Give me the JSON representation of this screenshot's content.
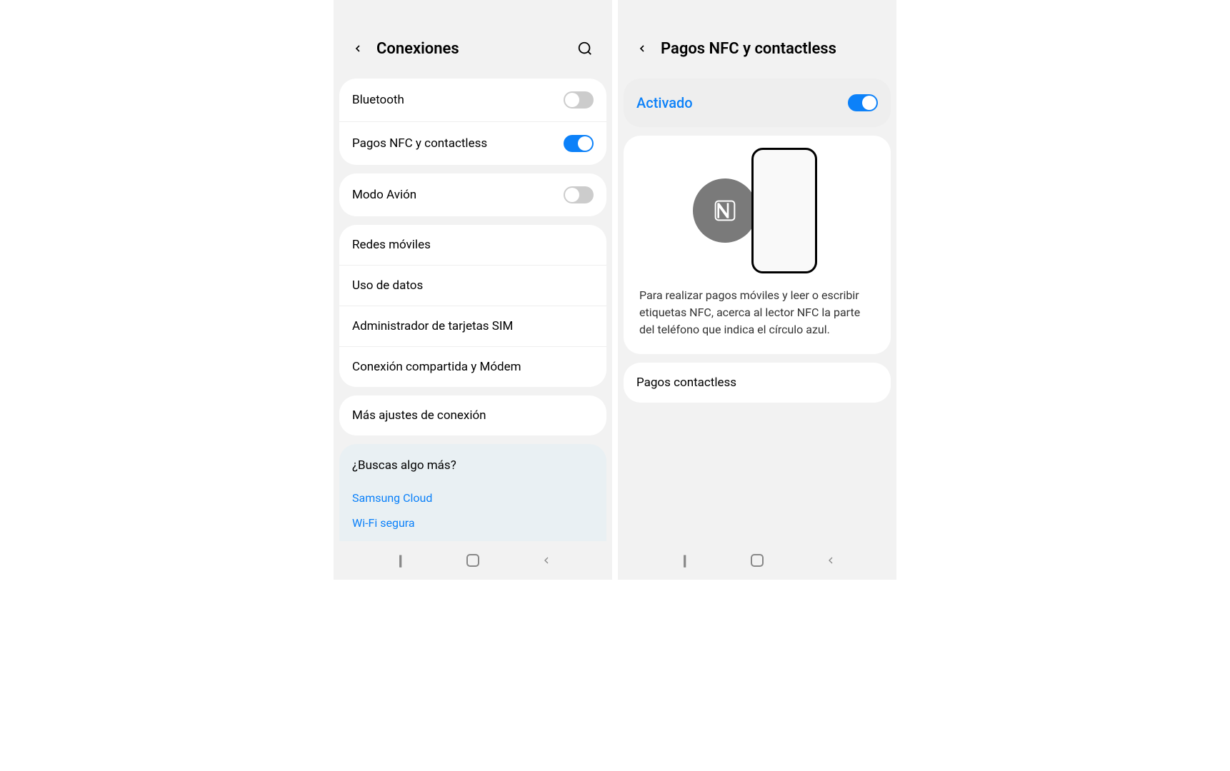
{
  "left": {
    "title": "Conexiones",
    "group1": [
      {
        "label": "Bluetooth",
        "toggle": "off"
      },
      {
        "label": "Pagos NFC y contactless",
        "toggle": "on"
      }
    ],
    "group2": [
      {
        "label": "Modo Avión",
        "toggle": "off"
      }
    ],
    "group3": [
      {
        "label": "Redes móviles"
      },
      {
        "label": "Uso de datos"
      },
      {
        "label": "Administrador de tarjetas SIM"
      },
      {
        "label": "Conexión compartida y Módem"
      }
    ],
    "group4": [
      {
        "label": "Más ajustes de conexión"
      }
    ],
    "suggestion": {
      "title": "¿Buscas algo más?",
      "links": [
        "Samsung Cloud",
        "Wi-Fi segura"
      ]
    }
  },
  "right": {
    "title": "Pagos NFC y contactless",
    "activado": {
      "label": "Activado",
      "toggle": "on"
    },
    "description": "Para realizar pagos móviles y leer o escribir etiquetas NFC, acerca al lector NFC la parte del teléfono que indica el círculo azul.",
    "contactless": "Pagos contactless"
  }
}
